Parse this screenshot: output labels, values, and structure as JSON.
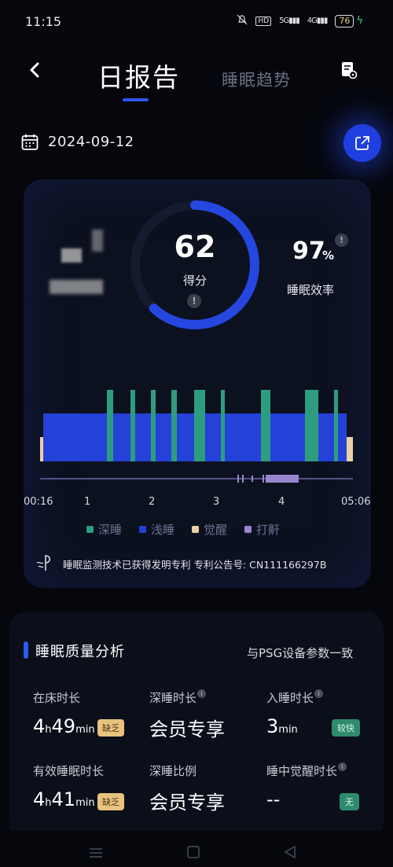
{
  "status_bar": {
    "time": "11:15",
    "hd": "HD",
    "sig1": "5G",
    "sig2": "4G",
    "battery": "76"
  },
  "header": {
    "tab_day": "日报告",
    "tab_trend": "睡眠趋势"
  },
  "date": "2024-09-12",
  "score": {
    "value": "62",
    "label": "得分",
    "progress": 0.62,
    "info": "!"
  },
  "efficiency": {
    "value": "97",
    "unit": "%",
    "label": "睡眠效率",
    "info": "!"
  },
  "colors": {
    "deep": "#2e9c7e",
    "light": "#2542d8",
    "awake": "#ecd1a4",
    "snore": "#9a86cf",
    "accent": "#2d57f0"
  },
  "sleep_chart": {
    "time_labels": [
      "00:16",
      "1",
      "2",
      "3",
      "4",
      "05:06"
    ],
    "legend": [
      {
        "name": "深睡",
        "color": "#2e9c7e"
      },
      {
        "name": "浅睡",
        "color": "#2542d8"
      },
      {
        "name": "觉醒",
        "color": "#ecd1a4"
      },
      {
        "name": "打鼾",
        "color": "#9a86cf"
      }
    ]
  },
  "patent": "睡眠监测技术已获得发明专利   专利公告号: CN111166297B",
  "quality": {
    "title": "睡眠质量分析",
    "psg": "与PSG设备参数一致",
    "metrics": [
      {
        "label": "在床时长",
        "h": "4",
        "h_unit": "h",
        "m": "49",
        "m_unit": "min",
        "badge": "缺乏"
      },
      {
        "label": "深睡时长",
        "value": "会员专享",
        "info": "i"
      },
      {
        "label": "入睡时长",
        "value": "3",
        "unit": "min",
        "badge": "较快",
        "info": "i"
      },
      {
        "label": "有效睡眠时长",
        "h": "4",
        "h_unit": "h",
        "m": "41",
        "m_unit": "min",
        "badge": "缺乏"
      },
      {
        "label": "深睡比例",
        "value": "会员专享"
      },
      {
        "label": "睡中觉醒时长",
        "value": "--",
        "badge": "无",
        "info": "i"
      }
    ]
  }
}
